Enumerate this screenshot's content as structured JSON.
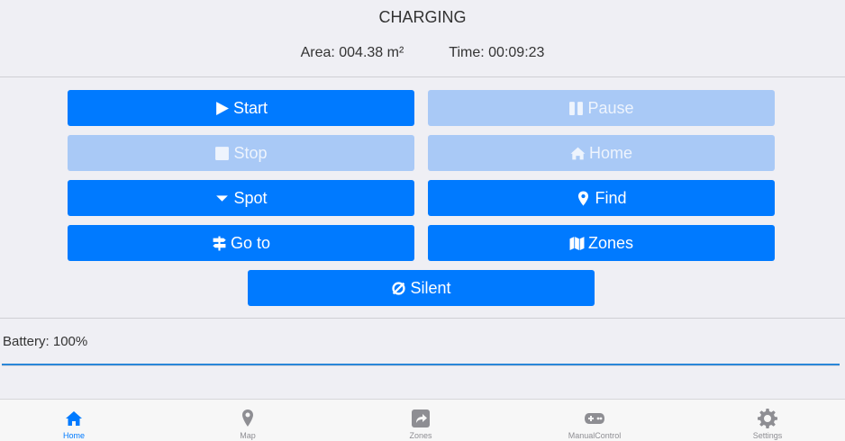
{
  "status": {
    "title": "CHARGING",
    "area": "Area: 004.38 m²",
    "time": "Time: 00:09:23"
  },
  "buttons": {
    "start": {
      "label": "Start",
      "icon": "play-icon",
      "enabled": true
    },
    "pause": {
      "label": "Pause",
      "icon": "pause-icon",
      "enabled": false
    },
    "stop": {
      "label": "Stop",
      "icon": "stop-icon",
      "enabled": false
    },
    "home": {
      "label": "Home",
      "icon": "home-icon",
      "enabled": false
    },
    "spot": {
      "label": "Spot",
      "icon": "caret-down-icon",
      "enabled": true
    },
    "find": {
      "label": "Find",
      "icon": "map-marker-icon",
      "enabled": true
    },
    "goto": {
      "label": "Go to",
      "icon": "signpost-icon",
      "enabled": true
    },
    "zones": {
      "label": "Zones",
      "icon": "map-icon",
      "enabled": true
    },
    "silent": {
      "label": "Silent",
      "icon": "silent-icon",
      "enabled": true
    }
  },
  "battery": {
    "label": "Battery: 100%",
    "level": 1.0
  },
  "tabs": [
    {
      "label": "Home",
      "icon": "home-icon",
      "active": true
    },
    {
      "label": "Map",
      "icon": "map-marker-icon",
      "active": false
    },
    {
      "label": "Zones",
      "icon": "share-square-icon",
      "active": false
    },
    {
      "label": "ManualControl",
      "icon": "gamepad-icon",
      "active": false
    },
    {
      "label": "Settings",
      "icon": "gear-icon",
      "active": false
    }
  ],
  "colors": {
    "accent": "#007aff",
    "disabled": "#a9c9f6",
    "background": "#efeff4"
  }
}
